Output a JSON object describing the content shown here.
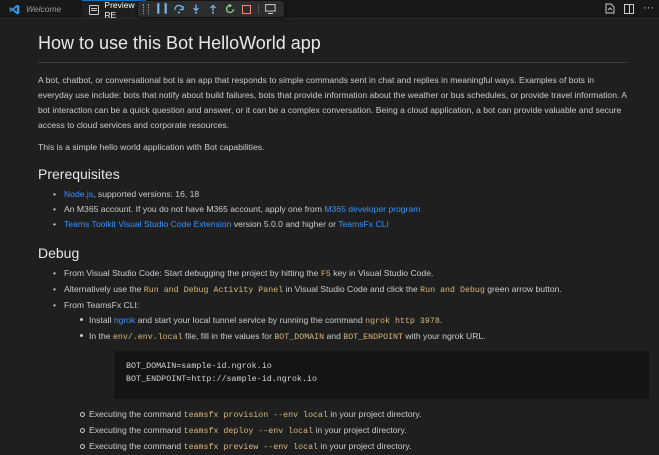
{
  "tabs": [
    {
      "label": "Welcome"
    },
    {
      "label": "Preview RE"
    }
  ],
  "debug_toolbar": [
    "pause",
    "step-over",
    "step-into",
    "step-out",
    "restart",
    "stop",
    "edit"
  ],
  "doc": {
    "title": "How to use this Bot HelloWorld app",
    "intro": "A bot, chatbot, or conversational bot is an app that responds to simple commands sent in chat and replies in meaningful ways. Examples of bots in everyday use include: bots that notify about build failures, bots that provide information about the weather or bus schedules, or provide travel information. A bot interaction can be a quick question and answer, or it can be a complex conversation. Being a cloud application, a bot can provide valuable and secure access to cloud services and corporate resources.",
    "intro2": "This is a simple hello world application with Bot capabilities.",
    "prereq": {
      "heading": "Prerequisites",
      "item1_link": "Node.js",
      "item1_text": ", supported versions: 16, 18",
      "item2_text": "An M365 account. If you do not have M365 account, apply one from ",
      "item2_link": "M365 developer program",
      "item3_link": "Teams Toolkit Visual Studio Code Extension",
      "item3_text": " version 5.0.0 and higher or ",
      "item3_link2": "TeamsFx CLI"
    },
    "debug": {
      "heading": "Debug",
      "item1_text": "From Visual Studio Code: Start debugging the project by hitting the ",
      "item1_code": "F5",
      "item1_text2": " key in Visual Studio Code.",
      "item2_text": "Alternatively use the ",
      "item2_code": "Run and Debug Activity Panel",
      "item2_text2": " in Visual Studio Code and click the ",
      "item2_code2": "Run and Debug",
      "item2_text3": " green arrow button.",
      "item3_text": "From TeamsFx CLI:",
      "sub1_text": "Install ",
      "sub1_link": "ngrok",
      "sub1_text2": " and start your local tunnel service by running the command ",
      "sub1_code": "ngrok http 3978",
      "sub1_text3": ".",
      "sub2_text": "In the ",
      "sub2_code": "env/.env.local",
      "sub2_text2": " file, fill in the values for ",
      "sub2_code2": "BOT_DOMAIN",
      "sub2_text3": " and ",
      "sub2_code3": "BOT_ENDPOINT",
      "sub2_text4": " with your ngrok URL.",
      "code_line1": "BOT_DOMAIN=sample-id.ngrok.io",
      "code_line2": "BOT_ENDPOINT=http://sample-id.ngrok.io",
      "sub3_text": "Executing the command ",
      "sub3_code": "teamsfx provision --env local",
      "sub3_text2": " in your project directory.",
      "sub4_text": "Executing the command ",
      "sub4_code": "teamsfx deploy --env local",
      "sub4_text2": " in your project directory.",
      "sub5_text": "Executing the command ",
      "sub5_code": "teamsfx preview --env local",
      "sub5_text2": " in your project directory."
    }
  }
}
